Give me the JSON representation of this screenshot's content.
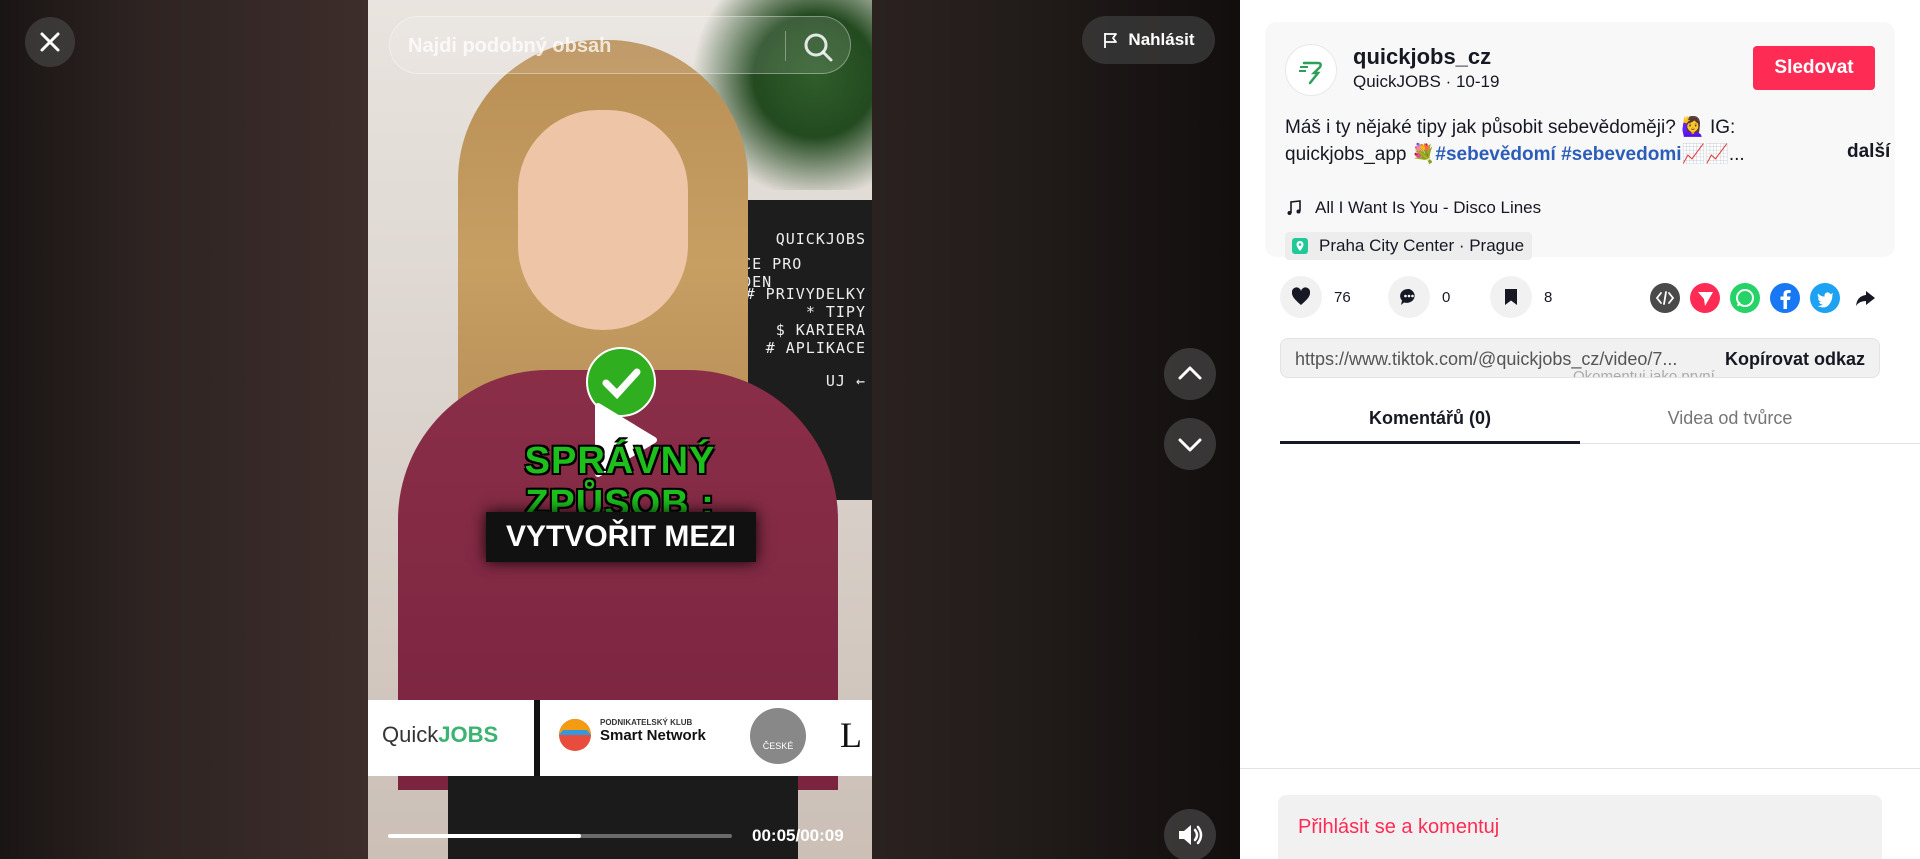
{
  "search": {
    "placeholder": "Najdi podobný obsah"
  },
  "report": {
    "label": "Nahlásit"
  },
  "video": {
    "board_lines": [
      "QUICKJOBS",
      "PRACE PRO STUDEN",
      "# PRIVYDELKY",
      "* TIPY",
      "$ KARIERA",
      "# APLIKACE",
      "UJ ←"
    ],
    "caption_line1": "SPRÁVNÝ ZPŮSOB :",
    "caption_line2": "VYTVOŘIT MEZI",
    "sponsors": {
      "quick": "Quick",
      "jobs": "JOBS",
      "club_small": "PODNIKATELSKÝ KLUB",
      "club_big": "Smart Network",
      "circle": "ČESKÉ",
      "letter": "L"
    },
    "time": "00:05/00:09",
    "progress": 0.56
  },
  "creator": {
    "handle": "quickjobs_cz",
    "subline": "QuickJOBS · 10-19",
    "follow_label": "Sledovat"
  },
  "description": {
    "text": "Máš i ty nějaké tipy jak působit sebevědoměji? 🙋‍♀️ IG: quickjobs_app 💐",
    "tag1": "#sebevědomí",
    "tag2": "#sebevedomi",
    "suffix": "📈📈...",
    "more": "další"
  },
  "music": "All I Want Is You - Disco Lines",
  "location": "Praha City Center · Prague",
  "stats": {
    "likes": "76",
    "comments": "0",
    "saves": "8"
  },
  "share_colors": {
    "embed": "#4a4a4a",
    "send": "#fe2c55",
    "whatsapp": "#25d366",
    "facebook": "#1877f2",
    "twitter": "#1da1f2"
  },
  "link": {
    "url": "https://www.tiktok.com/@quickjobs_cz/video/7...",
    "copy_label": "Kopírovat odkaz",
    "ghost": "Okomentuj jako první"
  },
  "tabs": {
    "comments": "Komentářů (0)",
    "videos": "Videa od tvůrce"
  },
  "login": {
    "label": "Přihlásit se a komentuj"
  }
}
